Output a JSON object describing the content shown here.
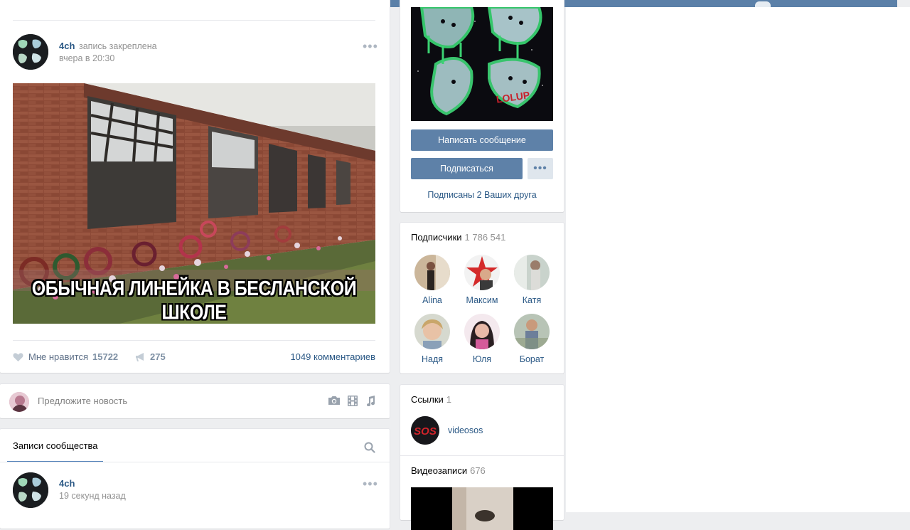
{
  "post": {
    "author": "4ch",
    "pinned_label": "запись закреплена",
    "time": "вчера в 20:30",
    "image_caption": "ОБЫЧНАЯ ЛИНЕЙКА В БЕСЛАНСКОЙ ШКОЛЕ",
    "like_label": "Мне нравится",
    "like_count": "15722",
    "share_count": "275",
    "comments": "1049 комментариев"
  },
  "suggest": {
    "placeholder": "Предложите новость"
  },
  "wall": {
    "tab_label": "Записи сообщества",
    "next_post": {
      "author": "4ch",
      "time": "19 секунд назад"
    }
  },
  "sidebar": {
    "message_button": "Написать сообщение",
    "subscribe_button": "Подписаться",
    "friends_note": "Подписаны 2 Ваших друга",
    "subscribers": {
      "title": "Подписчики",
      "count": "1 786 541",
      "people": [
        {
          "name": "Alina"
        },
        {
          "name": "Максим"
        },
        {
          "name": "Катя"
        },
        {
          "name": "Надя"
        },
        {
          "name": "Юля"
        },
        {
          "name": "Борат"
        }
      ]
    },
    "links": {
      "title": "Ссылки",
      "count": "1",
      "items": [
        {
          "name": "videosos",
          "logo_text": "SOS"
        }
      ]
    },
    "videos": {
      "title": "Видеозаписи",
      "count": "676"
    }
  },
  "colors": {
    "accent": "#5e81a8",
    "link": "#2a5885",
    "muted": "#939393",
    "top_bar": "#5b80a8"
  },
  "icons": [
    "heart-icon",
    "megaphone-icon",
    "camera-icon",
    "film-icon",
    "music-note-icon",
    "search-icon",
    "more-dots-icon"
  ]
}
